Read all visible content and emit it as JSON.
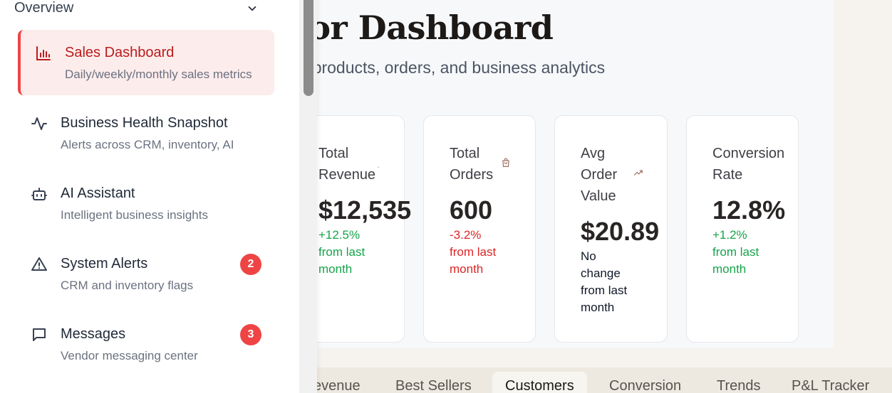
{
  "header": {
    "title": "endor Dashboard",
    "subtitle": "nage your products, orders, and business analytics"
  },
  "cards": [
    {
      "label": "Total Revenue",
      "value": "$12,535",
      "change_pct": "+12.5%",
      "change_text": "from last month",
      "trend": "up",
      "icon": "dollar-icon"
    },
    {
      "label": "Total Orders",
      "value": "600",
      "change_pct": "-3.2%",
      "change_text": "from last month",
      "trend": "down",
      "icon": "shopping-bag-icon"
    },
    {
      "label": "Avg Order Value",
      "value": "$20.89",
      "change_text": "No change from last month",
      "trend": "none",
      "icon": "trending-up-icon"
    },
    {
      "label": "Conversion Rate",
      "value": "12.8%",
      "change_pct": "+1.2%",
      "change_text": "from last month",
      "trend": "up"
    }
  ],
  "tabs": [
    "evenue",
    "Best Sellers",
    "Customers",
    "Conversion",
    "Trends",
    "P&L Tracker"
  ],
  "active_tab": "Customers",
  "sidebar": {
    "section_label": "Overview",
    "items": [
      {
        "title": "Sales Dashboard",
        "subtitle": "Daily/weekly/monthly sales metrics",
        "icon": "bar-chart-icon",
        "active": true
      },
      {
        "title": "Business Health Snapshot",
        "subtitle": "Alerts across CRM, inventory, AI",
        "icon": "activity-icon"
      },
      {
        "title": "AI Assistant",
        "subtitle": "Intelligent business insights",
        "icon": "bot-icon"
      },
      {
        "title": "System Alerts",
        "subtitle": "CRM and inventory flags",
        "icon": "alert-triangle-icon",
        "badge": "2"
      },
      {
        "title": "Messages",
        "subtitle": "Vendor messaging center",
        "icon": "message-square-icon",
        "badge": "3"
      }
    ]
  },
  "colors": {
    "accent": "#ef4444",
    "positive": "#16a34a",
    "negative": "#dc2626",
    "active_bg": "#fdecec"
  }
}
